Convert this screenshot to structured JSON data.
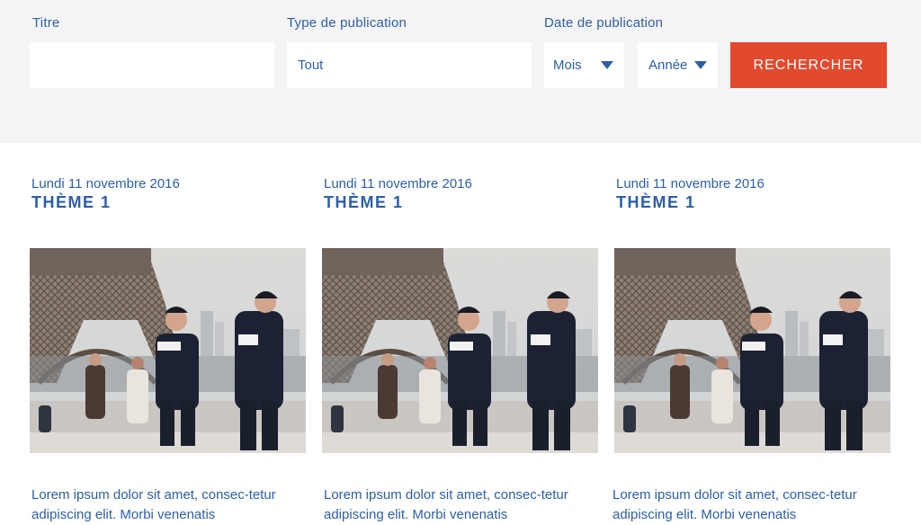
{
  "filters": {
    "title_label": "Titre",
    "title_value": "",
    "type_label": "Type de publication",
    "type_value": "Tout",
    "date_label": "Date de publication",
    "month_value": "Mois",
    "year_value": "Année",
    "search_label": "RECHERCHER"
  },
  "colors": {
    "accent": "#e2492d",
    "text": "#2d5ea8",
    "filter_bg": "#f4f4f5"
  },
  "cards": [
    {
      "date": "Lundi 11 novembre 2016",
      "theme": "THÈME 1",
      "excerpt": "Lorem ipsum dolor sit amet, consec-tetur adipiscing elit. Morbi venenatis"
    },
    {
      "date": "Lundi 11 novembre 2016",
      "theme": "THÈME 1",
      "excerpt": "Lorem ipsum dolor sit amet, consec-tetur adipiscing elit. Morbi venenatis"
    },
    {
      "date": "Lundi 11 novembre 2016",
      "theme": "THÈME 1",
      "excerpt": "Lorem ipsum dolor sit amet, consec-tetur adipiscing elit. Morbi venenatis"
    }
  ]
}
